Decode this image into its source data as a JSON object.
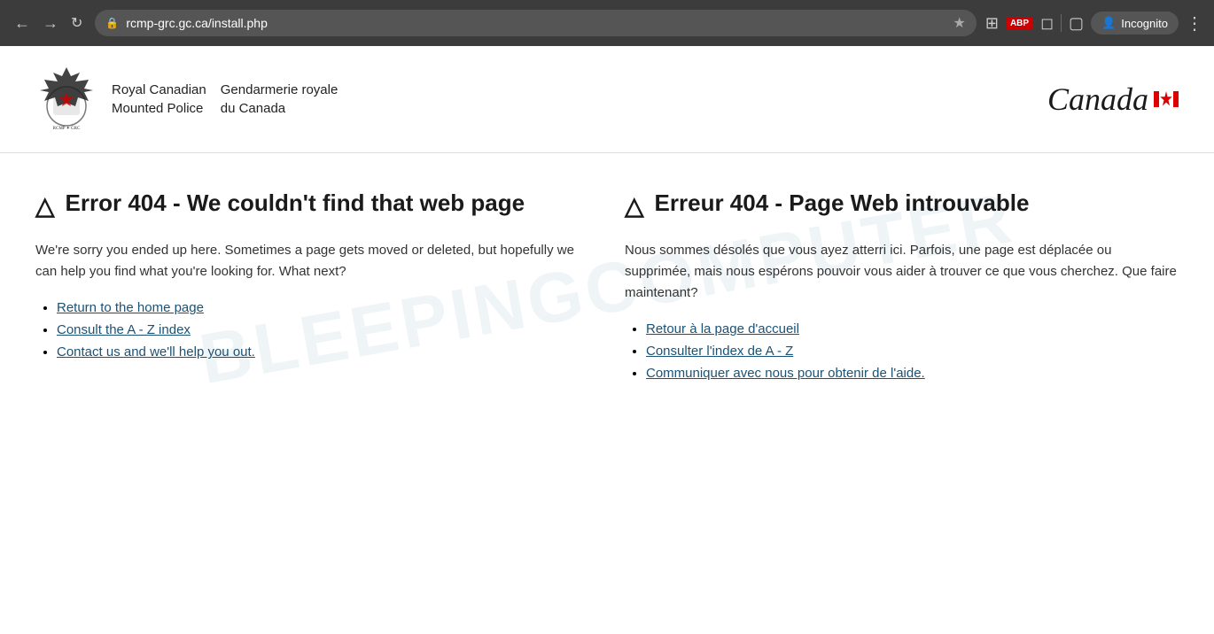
{
  "browser": {
    "url": "rcmp-grc.gc.ca/install.php",
    "incognito_label": "Incognito",
    "abp_label": "ABP"
  },
  "header": {
    "logo_alt": "RCMP Crest",
    "org_name_en": "Royal Canadian\nMounted Police",
    "org_name_fr": "Gendarmerie royale\ndu Canada",
    "canada_wordmark": "Canada"
  },
  "english_section": {
    "heading": "Error 404 - We couldn't find that web page",
    "description": "We're sorry you ended up here. Sometimes a page gets moved or deleted, but hopefully we can help you find what you're looking for. What next?",
    "links": [
      {
        "text": "Return to the home page",
        "href": "#"
      },
      {
        "text": "Consult the A - Z index",
        "href": "#"
      },
      {
        "text": "Contact us and we'll help you out.",
        "href": "#"
      }
    ]
  },
  "french_section": {
    "heading": "Erreur 404 - Page Web introuvable",
    "description": "Nous sommes désolés que vous ayez atterri ici. Parfois, une page est déplacée ou supprimée, mais nous espérons pouvoir vous aider à trouver ce que vous cherchez. Que faire maintenant?",
    "links": [
      {
        "text": "Retour à la page d'accueil",
        "href": "#"
      },
      {
        "text": "Consulter l'index de A - Z",
        "href": "#"
      },
      {
        "text": "Communiquer avec nous pour obtenir de l'aide.",
        "href": "#"
      }
    ]
  },
  "watermark": "BLEEPINGCOMPUTER"
}
